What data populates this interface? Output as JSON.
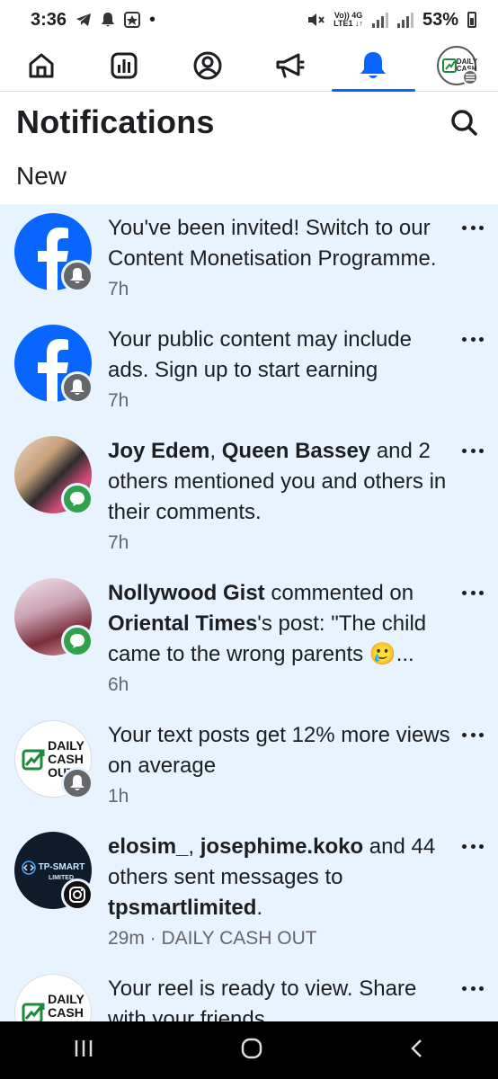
{
  "status_bar": {
    "time": "3:36",
    "network_top": "Vo)) 4G",
    "network_bottom": "LTE1 ↓↑",
    "battery": "53%"
  },
  "nav": {
    "items": [
      "home-icon",
      "dashboard-icon",
      "profile-icon",
      "megaphone-icon",
      "bell-icon",
      "profile-avatar"
    ],
    "active_index": 4,
    "avatar_text": "DAILY CASH"
  },
  "header": {
    "title": "Notifications"
  },
  "section": {
    "title": "New"
  },
  "notifications": [
    {
      "parts": [
        {
          "t": "You've been invited! Switch to our Content Monetisation Programme.",
          "b": false
        }
      ],
      "time": "7h"
    },
    {
      "parts": [
        {
          "t": "Your public content may include ads. Sign up to start earning",
          "b": false
        }
      ],
      "time": "7h"
    },
    {
      "parts": [
        {
          "t": "Joy Edem",
          "b": true
        },
        {
          "t": ", ",
          "b": false
        },
        {
          "t": "Queen Bassey",
          "b": true
        },
        {
          "t": " and 2 others mentioned you and others in their comments.",
          "b": false
        }
      ],
      "time": "7h"
    },
    {
      "parts": [
        {
          "t": "Nollywood Gist",
          "b": true
        },
        {
          "t": " commented on ",
          "b": false
        },
        {
          "t": "Oriental Times",
          "b": true
        },
        {
          "t": "'s post: \"The child came to the wrong parents 🥲...",
          "b": false
        }
      ],
      "time": "6h"
    },
    {
      "parts": [
        {
          "t": "Your text posts get 12% more views on average",
          "b": false
        }
      ],
      "time": "1h"
    },
    {
      "parts": [
        {
          "t": "elosim_",
          "b": true
        },
        {
          "t": ", ",
          "b": false
        },
        {
          "t": "josephime.koko",
          "b": true
        },
        {
          "t": " and 44 others sent messages to ",
          "b": false
        },
        {
          "t": "tpsmartlimited",
          "b": true
        },
        {
          "t": ".",
          "b": false
        }
      ],
      "time": "29m · DAILY CASH OUT"
    },
    {
      "parts": [
        {
          "t": "Your reel is ready to view. Share with your friends.",
          "b": false
        }
      ],
      "time": ""
    }
  ],
  "avatars": {
    "dco_line1": "DAILY",
    "dco_line2": "CASH",
    "dco_line3": "OUT",
    "tp_line1": "TP-SMART",
    "tp_line2": "LIMITED"
  },
  "colors": {
    "facebook_blue": "#0866ff",
    "unread_bg": "#e7f3ff",
    "badge_gray": "#65676b",
    "badge_green": "#31a24c"
  }
}
